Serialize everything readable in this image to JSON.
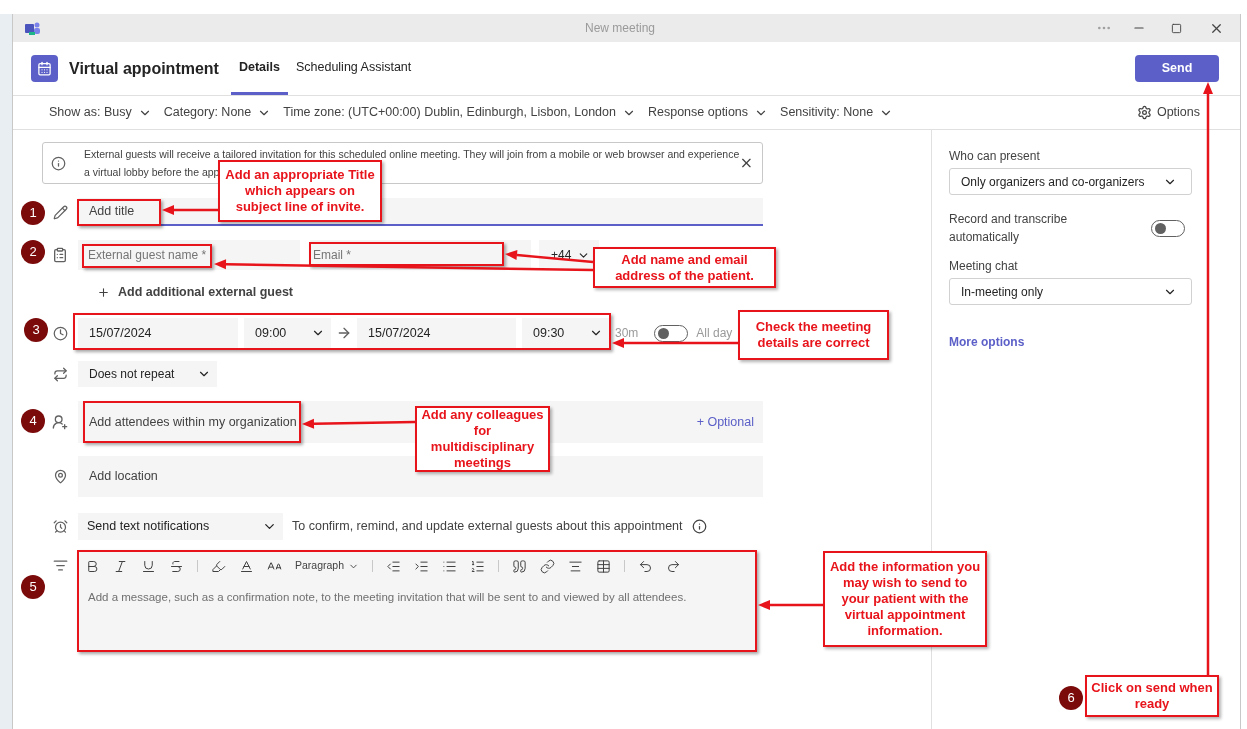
{
  "window": {
    "title": "New meeting"
  },
  "header": {
    "title": "Virtual appointment",
    "tabs": [
      {
        "label": "Details",
        "selected": true
      },
      {
        "label": "Scheduling Assistant",
        "selected": false
      }
    ],
    "send": "Send"
  },
  "toolbar": [
    {
      "label": "Show as: Busy"
    },
    {
      "label": "Category: None"
    },
    {
      "label": "Time zone: (UTC+00:00) Dublin, Edinburgh, Lisbon, London"
    },
    {
      "label": "Response options"
    },
    {
      "label": "Sensitivity: None"
    }
  ],
  "options": "Options",
  "banner": {
    "lines": [
      "External guests will receive a tailored invitation for this scheduled online meeting. They will join from a mobile or web browser and experience",
      "a virtual lobby before the app"
    ]
  },
  "form": {
    "title_placeholder": "Add title",
    "guest_name_placeholder": "External guest name *",
    "email_placeholder": "Email *",
    "country_code": "+44",
    "add_guest": "Add additional external guest",
    "start_date": "15/07/2024",
    "start_time": "09:00",
    "end_date": "15/07/2024",
    "end_time": "09:30",
    "duration": "30m",
    "all_day": {
      "label": "All day",
      "on": false
    },
    "repeat": "Does not repeat",
    "attendees_placeholder": "Add attendees within my organization",
    "optional": "+ Optional",
    "location_placeholder": "Add location",
    "sms": "Send text notifications",
    "sms_note": "To confirm, remind, and update external guests about this appointment",
    "editor": {
      "style": "Paragraph",
      "placeholder": "Add a message, such as a confirmation note, to the meeting invitation that will be sent to and viewed by all attendees."
    }
  },
  "side": {
    "present_label": "Who can present",
    "present_value": "Only organizers and co-organizers",
    "record_label": "Record and transcribe automatically",
    "record_on": false,
    "chat_label": "Meeting chat",
    "chat_value": "In-meeting only",
    "more": "More options"
  },
  "annotations": [
    {
      "text": "Add an appropriate Title which appears on subject line of invite."
    },
    {
      "text": "Add name and email address of the patient."
    },
    {
      "text": "Check the meeting details are correct"
    },
    {
      "text": "Add any colleagues for multidisciplinary meetings"
    },
    {
      "text": "Add the information you may wish to send to your patient with the virtual appointment information."
    },
    {
      "text": "Click on send when ready"
    }
  ],
  "steps": [
    "1",
    "2",
    "3",
    "4",
    "5",
    "6"
  ]
}
